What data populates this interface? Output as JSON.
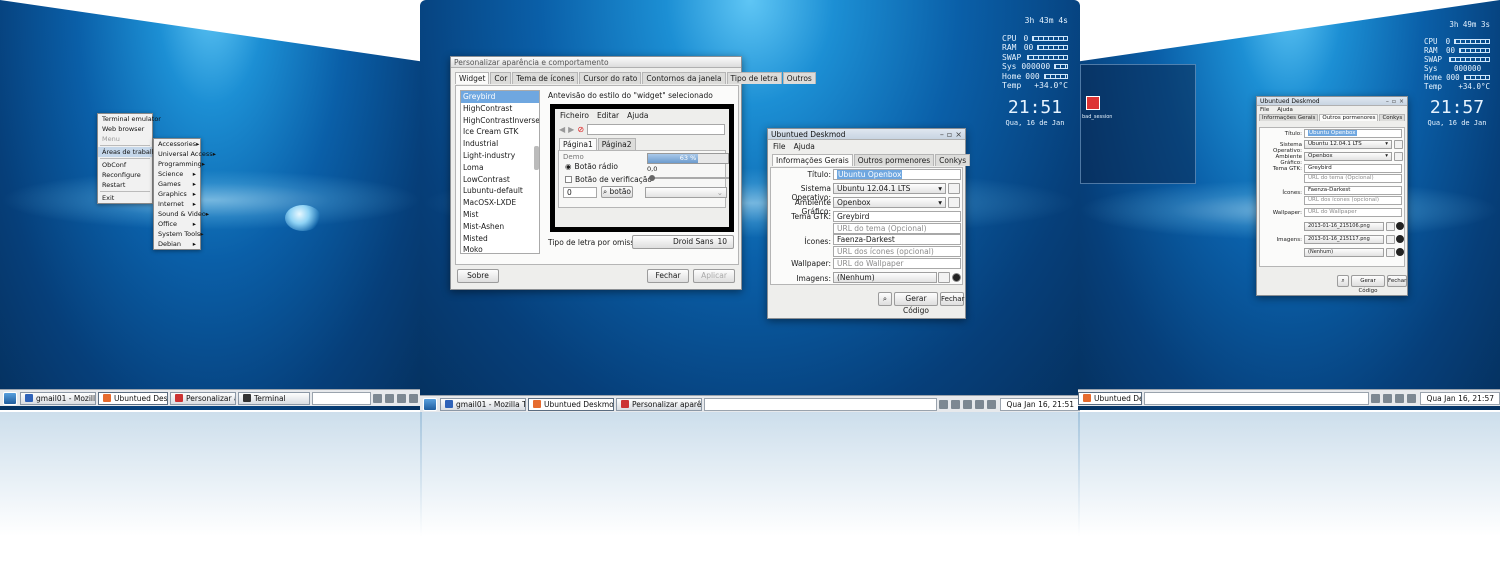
{
  "left": {
    "menu": {
      "items": [
        "Terminal emulator",
        "Web browser",
        "Menu",
        "Áreas de trabalho",
        "ObConf",
        "Reconfigure",
        "Restart",
        "Exit"
      ],
      "submenu": [
        "Accessories",
        "Universal Access",
        "Programming",
        "Science",
        "Games",
        "Graphics",
        "Internet",
        "Sound & Video",
        "Office",
        "System Tools",
        "Debian"
      ]
    },
    "taskbar": {
      "tasks": [
        "gmail01 - Mozilla Thun...",
        "Ubuntued Deskmod",
        "Personalizar aparência...",
        "Terminal"
      ]
    }
  },
  "conky_mid": {
    "uptime": "3h 43m 4s",
    "labels": [
      "CPU",
      "RAM",
      "SWAP",
      "Sys",
      "Home",
      "Temp"
    ],
    "values": [
      "0",
      "00",
      "",
      "000000",
      "000",
      "+34.0°C"
    ],
    "time": "21:51",
    "date": "Qua, 16 de Jan"
  },
  "conky_right": {
    "uptime": "3h 49m 3s",
    "labels": [
      "CPU",
      "RAM",
      "SWAP",
      "Sys",
      "Home",
      "Temp"
    ],
    "values": [
      "0",
      "00",
      "",
      "000000",
      "000",
      "+34.0°C"
    ],
    "time": "21:57",
    "date": "Qua, 16 de Jan"
  },
  "lxap": {
    "title": "Personalizar aparência e comportamento",
    "tabs": [
      "Widget",
      "Cor",
      "Tema de ícones",
      "Cursor do rato",
      "Contornos da janela",
      "Tipo de letra",
      "Outros"
    ],
    "themes": [
      "Greybird",
      "HighContrast",
      "HighContrastInverse",
      "Ice Cream GTK",
      "Industrial",
      "Light-industry",
      "Loma",
      "LowContrast",
      "Lubuntu-default",
      "MacOSX-LXDE",
      "Mist",
      "Mist-Ashen",
      "Misted",
      "Moko"
    ],
    "preview_label": "Antevisão do estilo do \"widget\" selecionado",
    "preview_menu": [
      "Ficheiro",
      "Editar",
      "Ajuda"
    ],
    "preview_tabs": [
      "Página1",
      "Página2"
    ],
    "demo": "Demo",
    "radio": "Botão rádio",
    "check": "Botão de verificação",
    "progress": "63 %",
    "progress_value": 0.63,
    "scale_value": "0,0",
    "spin": "0",
    "button": "botão",
    "font_label": "Tipo de letra por omissão:",
    "font_name": "Droid Sans",
    "font_size": "10",
    "about": "Sobre",
    "close": "Fechar",
    "apply": "Aplicar"
  },
  "deskmod": {
    "title": "Ubuntued Deskmod",
    "menu": [
      "File",
      "Ajuda"
    ],
    "tabs": [
      "Informações Gerais",
      "Outros pormenores",
      "Conkys"
    ],
    "labels": {
      "titulo": "Título:",
      "so": "Sistema Operativo:",
      "ag": "Ambiente Gráfico:",
      "gtk": "Tema GTK:",
      "icons": "Ícones:",
      "wall": "Wallpaper:",
      "imgs": "Imagens:"
    },
    "values": {
      "titulo": "Ubuntu Openbox",
      "so": "Ubuntu 12.04.1 LTS",
      "ag": "Openbox",
      "gtk": "Greybird",
      "gtk_url": "URL do tema (Opcional)",
      "icons": "Faenza-Darkest",
      "icons_url": "URL dos ícones (opcional)",
      "wall": "URL do Wallpaper",
      "imgs": "(Nenhum)"
    },
    "buttons": {
      "gen": "Gerar Código",
      "close": "Fechar"
    }
  },
  "deskmod_right": {
    "title": "Ubuntued Deskmod",
    "menu": [
      "File",
      "Ajuda"
    ],
    "tabs": [
      "Informações Gerais",
      "Outros pormenores",
      "Conkys"
    ],
    "labels": {
      "titulo": "Título:",
      "so": "Sistema Operativo:",
      "ag": "Ambiente Gráfico:",
      "gtk": "Tema GTK:",
      "icons": "Ícones:",
      "wall": "Wallpaper:",
      "imgs": "Imagens:"
    },
    "values": {
      "titulo": "Ubuntu Openbox",
      "so": "Ubuntu 12.04.1 LTS",
      "ag": "Openbox",
      "gtk": "Greybird",
      "gtk_url": "URL do tema (Opcional)",
      "icons": "Faenza-Darkest",
      "icons_url": "URL dos ícones (opcional)",
      "wall": "URL do Wallpaper",
      "img1": "2013-01-16_215106.png",
      "img2": "2013-01-16_215117.png",
      "img3": "(Nenhum)"
    },
    "buttons": {
      "gen": "Gerar Código",
      "close": "Fechar"
    }
  },
  "mid_taskbar": {
    "tasks": [
      "gmail01 - Mozilla Thun...",
      "Ubuntued Deskmod",
      "Personalizar aparência..."
    ],
    "clock": "Qua Jan 16, 21:51"
  },
  "right_taskbar": {
    "tasks": [
      "Ubuntued Deskmod"
    ],
    "clock": "Qua Jan 16, 21:57"
  },
  "right_desktop_icon": "bad_session",
  "colors": {
    "accent": "#6fa7e0",
    "desktop": "#0a5fa8",
    "taskbar": "#e7e9ec"
  }
}
